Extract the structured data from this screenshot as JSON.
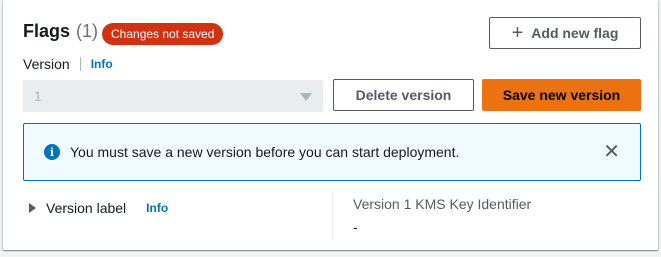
{
  "header": {
    "title": "Flags",
    "count": "(1)",
    "badge": "Changes not saved",
    "add_button_label": "Add new flag"
  },
  "version": {
    "label": "Version",
    "info_link": "Info",
    "selected_value": "1",
    "delete_button_label": "Delete version",
    "save_button_label": "Save new version"
  },
  "alert": {
    "message": "You must save a new version before you can start deployment."
  },
  "details": {
    "version_label_toggle": "Version label",
    "version_label_info": "Info",
    "kms_label": "Version 1 KMS Key Identifier",
    "kms_value": "-"
  },
  "colors": {
    "badge": "#d13212",
    "primary_button": "#ec7211",
    "link": "#0073bb",
    "alert_background": "#f1faff"
  },
  "icons": {
    "add": "plus-icon",
    "select_caret": "caret-down-icon",
    "alert_info": "info-circle-icon",
    "alert_close": "close-icon",
    "expand": "caret-right-icon"
  }
}
